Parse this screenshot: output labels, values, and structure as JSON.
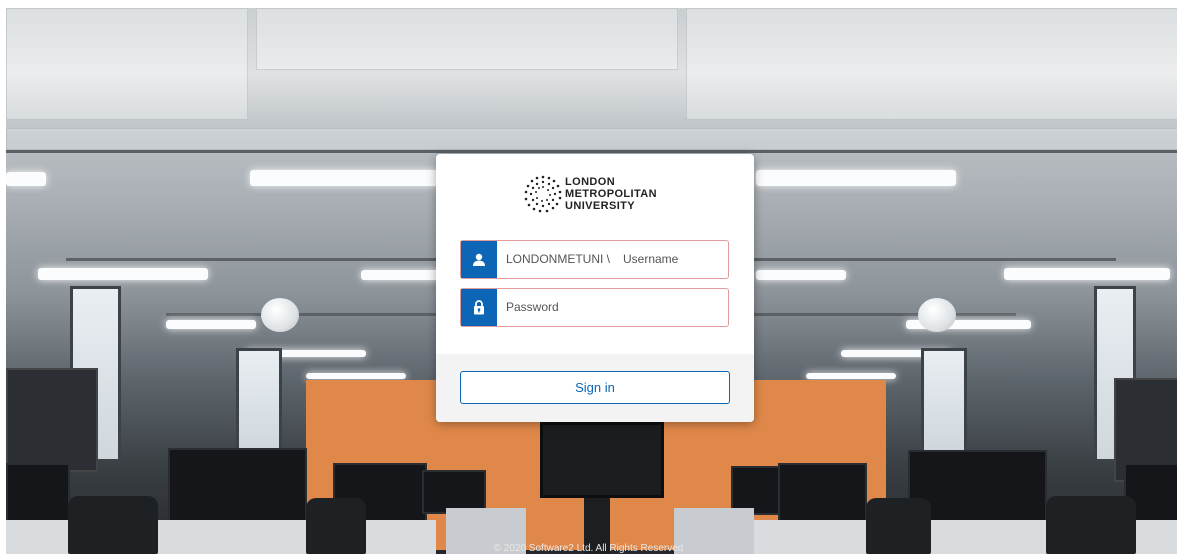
{
  "brand": {
    "logo_lines": [
      "LONDON",
      "METROPOLITAN",
      "UNIVERSITY"
    ]
  },
  "login": {
    "domain_prefix": "LONDONMETUNI \\",
    "username_placeholder": "Username",
    "password_placeholder": "Password",
    "signin_label": "Sign in"
  },
  "footer": {
    "copyright": "© 2020 Software2 Ltd. All Rights Reserved"
  },
  "colors": {
    "accent": "#0c66b5",
    "field_border": "#e39a9a",
    "wall_orange": "#e0884a"
  },
  "icons": {
    "username": "user-icon",
    "password": "lock-icon"
  }
}
